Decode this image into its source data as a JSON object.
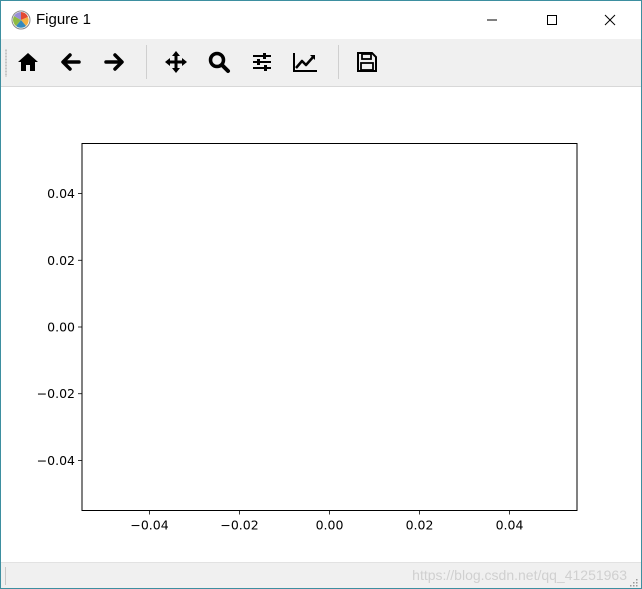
{
  "window": {
    "title": "Figure 1"
  },
  "toolbar": {
    "buttons": [
      {
        "name": "home-button",
        "icon": "home-icon"
      },
      {
        "name": "back-button",
        "icon": "arrow-left-icon"
      },
      {
        "name": "forward-button",
        "icon": "arrow-right-icon"
      },
      {
        "name": "pan-button",
        "icon": "move-icon"
      },
      {
        "name": "zoom-button",
        "icon": "magnifier-icon"
      },
      {
        "name": "subplots-button",
        "icon": "sliders-icon"
      },
      {
        "name": "edit-axis-button",
        "icon": "line-chart-icon"
      },
      {
        "name": "save-button",
        "icon": "floppy-disk-icon"
      }
    ]
  },
  "chart_data": {
    "type": "line",
    "title": "",
    "xlabel": "",
    "ylabel": "",
    "xlim": [
      -0.055,
      0.055
    ],
    "ylim": [
      -0.055,
      0.055
    ],
    "grid": false,
    "series": [],
    "x_ticks": [
      -0.04,
      -0.02,
      0.0,
      0.02,
      0.04
    ],
    "x_tick_labels": [
      "−0.04",
      "−0.02",
      "0.00",
      "0.02",
      "0.04"
    ],
    "y_ticks": [
      -0.04,
      -0.02,
      0.0,
      0.02,
      0.04
    ],
    "y_tick_labels": [
      "−0.04",
      "−0.02",
      "0.00",
      "0.02",
      "0.04"
    ]
  },
  "statusbar": {
    "watermark": "https://blog.csdn.net/qq_41251963"
  }
}
